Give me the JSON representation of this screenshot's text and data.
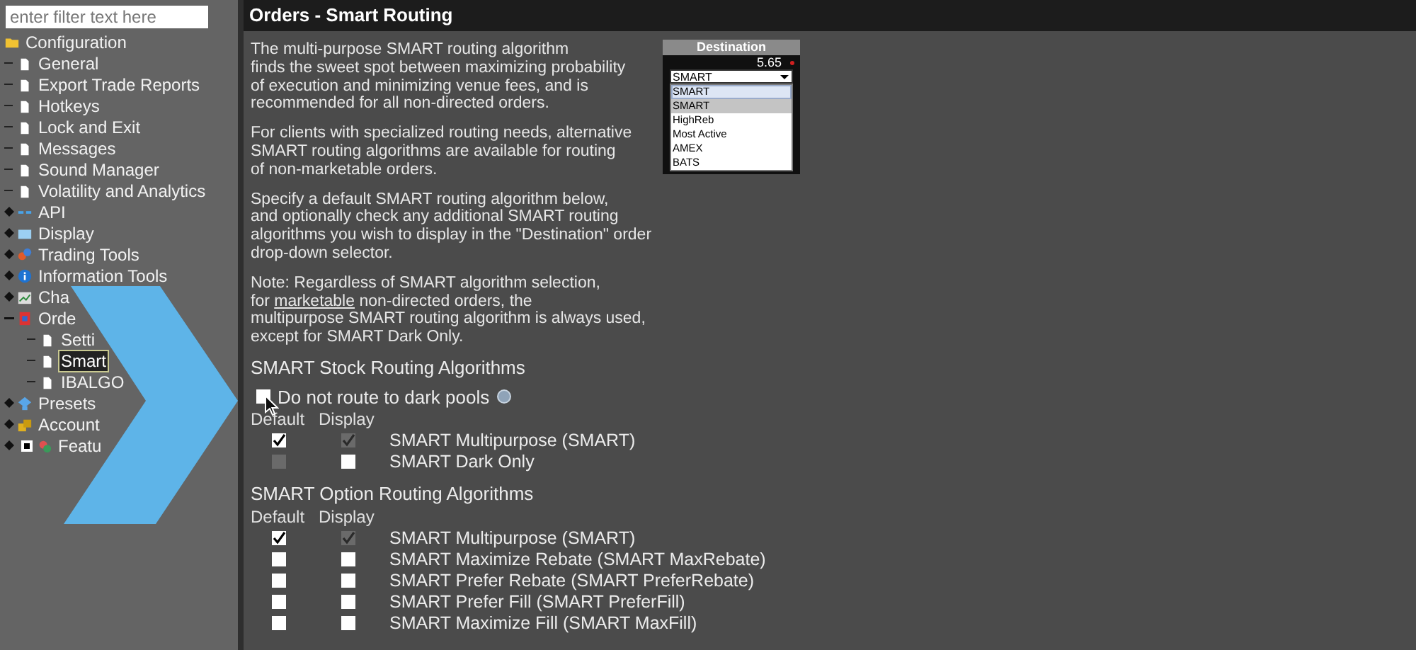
{
  "filter": {
    "placeholder": "enter filter text here"
  },
  "tree": [
    {
      "label": "Configuration",
      "kind": "folder",
      "expanded": true,
      "children": [
        {
          "label": "General",
          "kind": "page"
        },
        {
          "label": "Export Trade Reports",
          "kind": "page"
        },
        {
          "label": "Hotkeys",
          "kind": "page"
        },
        {
          "label": "Lock and Exit",
          "kind": "page"
        },
        {
          "label": "Messages",
          "kind": "page"
        },
        {
          "label": "Sound Manager",
          "kind": "page"
        },
        {
          "label": "Volatility and Analytics",
          "kind": "page"
        },
        {
          "label": "API",
          "kind": "api",
          "expanded": false
        },
        {
          "label": "Display",
          "kind": "display",
          "expanded": false
        },
        {
          "label": "Trading Tools",
          "kind": "tools",
          "expanded": false
        },
        {
          "label": "Information Tools",
          "kind": "info",
          "expanded": false
        },
        {
          "label": "Cha",
          "kind": "chart",
          "expanded": false
        },
        {
          "label": "Orde",
          "kind": "orders",
          "expanded": true,
          "children": [
            {
              "label": "Setti",
              "kind": "page",
              "selected": false
            },
            {
              "label": "Smart",
              "kind": "page",
              "selected": true
            },
            {
              "label": "IBALGO",
              "kind": "page",
              "selected": false
            }
          ]
        },
        {
          "label": "Presets",
          "kind": "presets",
          "expanded": false
        },
        {
          "label": "Account",
          "kind": "account",
          "expanded": false
        },
        {
          "label": "Featu",
          "kind": "features",
          "expanded": false
        }
      ]
    }
  ],
  "panel": {
    "title": "Orders - Smart Routing",
    "paragraphs": [
      {
        "lines": [
          "The multi-purpose SMART routing algorithm",
          "finds the sweet spot between maximizing probability",
          "of execution and minimizing venue fees, and is",
          "recommended for all non-directed orders."
        ]
      },
      {
        "lines": [
          "For clients with specialized routing needs, alternative",
          "SMART routing algorithms are available for routing",
          "of non-marketable orders."
        ]
      },
      {
        "lines": [
          "Specify a default SMART routing algorithm below,",
          "and optionally check any additional SMART routing",
          "algorithms you wish to display in the \"Destination\" order",
          "drop-down selector."
        ]
      },
      {
        "lines": [
          "Note: Regardless of SMART algorithm selection,",
          {
            "before": "for ",
            "link": "marketable",
            "after": " non-directed orders, the"
          },
          "multipurpose SMART routing algorithm is always used,",
          "except for SMART Dark Only."
        ]
      }
    ],
    "destination_preview": {
      "header": "Destination",
      "price": "5.65",
      "select_value": "SMART",
      "options": [
        {
          "label": "SMART",
          "selected": true,
          "hovered": false
        },
        {
          "label": "SMART",
          "selected": false,
          "hovered": true
        },
        {
          "label": "HighReb",
          "selected": false,
          "hovered": false
        },
        {
          "label": "Most Active",
          "selected": false,
          "hovered": false
        },
        {
          "label": "AMEX",
          "selected": false,
          "hovered": false
        },
        {
          "label": "BATS",
          "selected": false,
          "hovered": false
        }
      ]
    },
    "stock_section": {
      "title": "SMART Stock Routing Algorithms",
      "dark_pools": {
        "label": "Do not route to dark pools",
        "checked": false
      },
      "columns": [
        "Default",
        "Display"
      ],
      "rows": [
        {
          "label": "SMART Multipurpose (SMART)",
          "default": {
            "checked": true,
            "disabled": false
          },
          "display": {
            "checked": true,
            "disabled": true
          }
        },
        {
          "label": "SMART Dark Only",
          "default": {
            "checked": false,
            "disabled": true
          },
          "display": {
            "checked": false,
            "disabled": false
          }
        }
      ]
    },
    "option_section": {
      "title": "SMART Option Routing Algorithms",
      "columns": [
        "Default",
        "Display"
      ],
      "rows": [
        {
          "label": "SMART Multipurpose (SMART)",
          "default": {
            "checked": true,
            "disabled": false
          },
          "display": {
            "checked": true,
            "disabled": true
          }
        },
        {
          "label": "SMART Maximize Rebate (SMART MaxRebate)",
          "default": {
            "checked": false,
            "disabled": false
          },
          "display": {
            "checked": false,
            "disabled": false
          }
        },
        {
          "label": "SMART Prefer Rebate (SMART PreferRebate)",
          "default": {
            "checked": false,
            "disabled": false
          },
          "display": {
            "checked": false,
            "disabled": false
          }
        },
        {
          "label": "SMART Prefer Fill (SMART PreferFill)",
          "default": {
            "checked": false,
            "disabled": false
          },
          "display": {
            "checked": false,
            "disabled": false
          }
        },
        {
          "label": "SMART Maximize Fill (SMART MaxFill)",
          "default": {
            "checked": false,
            "disabled": false
          },
          "display": {
            "checked": false,
            "disabled": false
          }
        }
      ]
    }
  }
}
